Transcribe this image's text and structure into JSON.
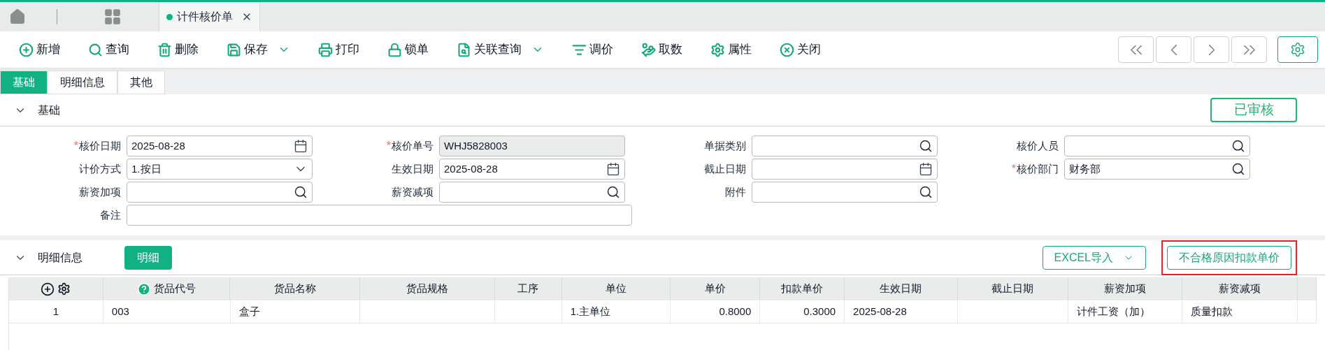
{
  "window_tabs": [
    {
      "kind": "home",
      "selected": false
    },
    {
      "kind": "apps",
      "selected": false
    },
    {
      "kind": "doc",
      "label": "计件核价单",
      "selected": true
    }
  ],
  "toolbar": [
    {
      "label": "新增",
      "dropdown": false
    },
    {
      "label": "查询",
      "dropdown": false
    },
    {
      "label": "删除",
      "dropdown": false
    },
    {
      "label": "保存",
      "dropdown": true
    },
    {
      "label": "打印",
      "dropdown": false
    },
    {
      "label": "锁单",
      "dropdown": false
    },
    {
      "label": "关联查询",
      "dropdown": true
    },
    {
      "label": "调价",
      "dropdown": false
    },
    {
      "label": "取数",
      "dropdown": false
    },
    {
      "label": "属性",
      "dropdown": false
    },
    {
      "label": "关闭",
      "dropdown": false
    }
  ],
  "sub_tabs": [
    {
      "label": "基础",
      "selected": true
    },
    {
      "label": "明细信息",
      "selected": false
    },
    {
      "label": "其他",
      "selected": false
    }
  ],
  "basic_section": {
    "title": "基础",
    "expanded": true,
    "status": "已审核",
    "rows": [
      [
        {
          "required_mark": "*",
          "label": "核价日期",
          "kind": "date",
          "value": "2025-08-28",
          "disabled": false
        },
        {
          "required_mark": "*",
          "label": "核价单号",
          "kind": "text",
          "value": "WHJ5828003",
          "disabled": true
        },
        {
          "label": "单据类别",
          "kind": "search",
          "disabled": false
        },
        {
          "label": "核价人员",
          "kind": "search",
          "disabled": false
        }
      ],
      [
        {
          "label": "计价方式",
          "kind": "select",
          "value": "1.按日",
          "disabled": false
        },
        {
          "label": "生效日期",
          "kind": "date",
          "value": "2025-08-28",
          "disabled": false
        },
        {
          "label": "截止日期",
          "kind": "date",
          "disabled": false
        },
        {
          "required_mark": "*",
          "label": "核价部门",
          "kind": "search",
          "value": "财务部",
          "disabled": false
        }
      ],
      [
        {
          "label": "薪资加项",
          "kind": "search",
          "disabled": false
        },
        {
          "label": "薪资减项",
          "kind": "search",
          "disabled": false
        },
        {
          "label": "附件",
          "kind": "search",
          "disabled": false
        }
      ],
      [
        {
          "label": "备注",
          "kind": "wide",
          "disabled": false
        }
      ]
    ]
  },
  "detail_section": {
    "title": "明细信息",
    "expanded": true,
    "tag": "明细",
    "buttons": [
      {
        "label": "EXCEL导入",
        "dropdown": true,
        "highlighted": false
      },
      {
        "label": "不合格原因扣款单价",
        "dropdown": false,
        "highlighted": true
      }
    ],
    "table": {
      "columns": [
        {
          "kind": "tools"
        },
        {
          "label": "货品代号",
          "help": true
        },
        {
          "label": "货品名称",
          "help": false
        },
        {
          "label": "货品规格",
          "help": false
        },
        {
          "label": "工序",
          "help": false
        },
        {
          "label": "单位",
          "help": false
        },
        {
          "label": "单价",
          "help": false
        },
        {
          "label": "扣款单价",
          "help": false
        },
        {
          "label": "生效日期",
          "help": false
        },
        {
          "label": "截止日期",
          "help": false
        },
        {
          "label": "薪资加项",
          "help": false
        },
        {
          "label": "薪资减项",
          "help": false
        }
      ],
      "rows": [
        [
          "1",
          "003",
          "盒子",
          "",
          "",
          "1.主单位",
          "0.8000",
          "0.3000",
          "2025-08-28",
          "",
          "计件工资（加）",
          "质量扣款"
        ]
      ]
    }
  }
}
